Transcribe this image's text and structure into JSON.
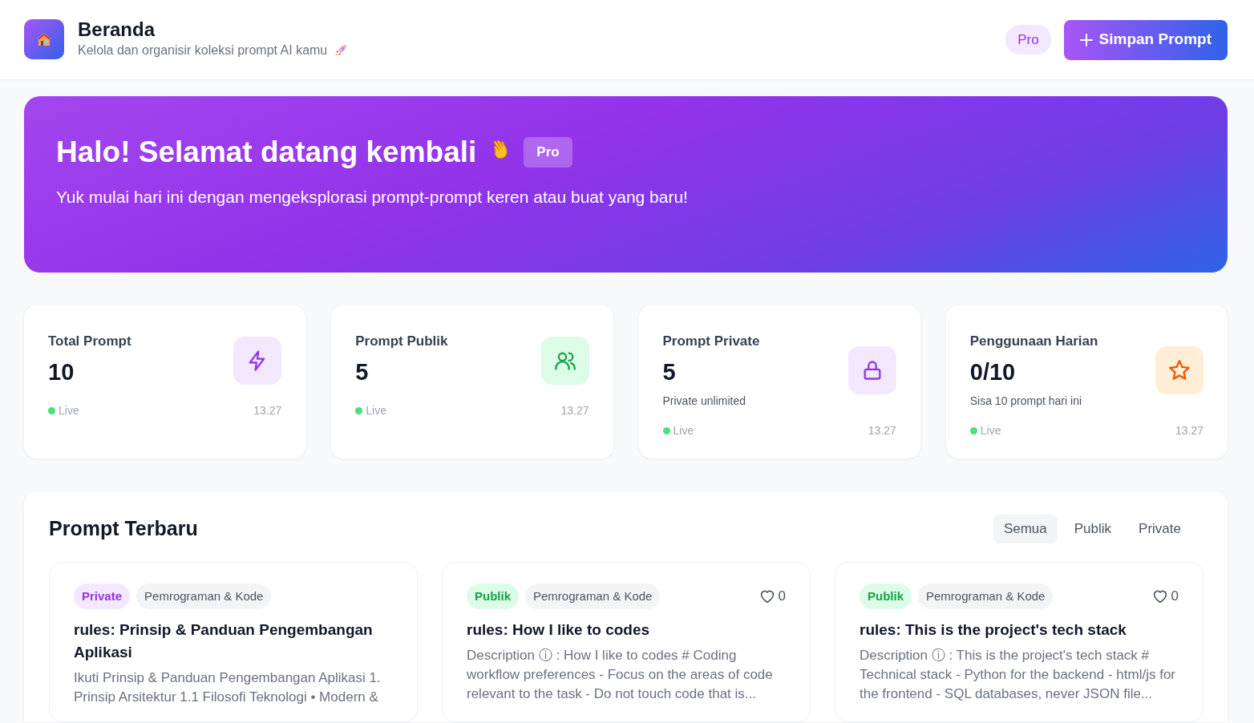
{
  "header": {
    "title": "Beranda",
    "subtitle": "Kelola dan organisir koleksi prompt AI kamu",
    "plan_badge": "Pro",
    "save_button": "Simpan Prompt"
  },
  "hero": {
    "title": "Halo! Selamat datang kembali",
    "badge": "Pro",
    "subtitle": "Yuk mulai hari ini dengan mengeksplorasi prompt-prompt keren atau buat yang baru!"
  },
  "stats": [
    {
      "label": "Total Prompt",
      "value": "10",
      "kind": "bolt",
      "status": "Live",
      "time": "13.27"
    },
    {
      "label": "Prompt Publik",
      "value": "5",
      "kind": "users",
      "status": "Live",
      "time": "13.27"
    },
    {
      "label": "Prompt Private",
      "value": "5",
      "note": "Private unlimited",
      "kind": "lock",
      "status": "Live",
      "time": "13.27"
    },
    {
      "label": "Penggunaan Harian",
      "value": "0/10",
      "note": "Sisa 10 prompt hari ini",
      "kind": "star",
      "status": "Live",
      "time": "13.27"
    }
  ],
  "recent": {
    "title": "Prompt Terbaru",
    "filters": [
      {
        "label": "Semua",
        "selected": true
      },
      {
        "label": "Publik",
        "selected": false
      },
      {
        "label": "Private",
        "selected": false
      }
    ],
    "prompts": [
      {
        "visibility": "Private",
        "kind": "private",
        "category": "Pemrograman & Kode",
        "title": "rules: Prinsip & Panduan Pengembangan Aplikasi",
        "description": "Ikuti Prinsip & Panduan Pengembangan Aplikasi 1. Prinsip Arsitektur 1.1 Filosofi Teknologi • Modern &"
      },
      {
        "visibility": "Publik",
        "kind": "public",
        "category": "Pemrograman & Kode",
        "likes": "0",
        "title": "rules: How I like to codes",
        "description": "Description ⓘ : How I like to codes # Coding workflow preferences - Focus on the areas of code relevant to the task - Do not touch code that is..."
      },
      {
        "visibility": "Publik",
        "kind": "public",
        "category": "Pemrograman & Kode",
        "likes": "0",
        "title": "rules: This is the project's tech stack",
        "description": "Description ⓘ : This is the project's tech stack # Technical stack - Python for the backend - html/js for the frontend - SQL databases, never JSON file..."
      }
    ]
  }
}
